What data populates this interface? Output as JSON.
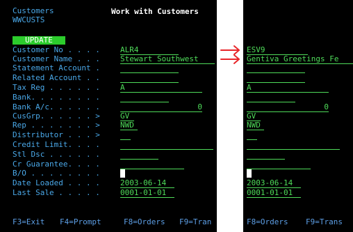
{
  "left": {
    "header": {
      "program_title": "Customers",
      "program_name": "WWCUSTS",
      "screen_title": "Work with Customers"
    },
    "mode_button": "UPDATE",
    "fields": [
      {
        "label": "Customer No . . . .",
        "value": "ALR4"
      },
      {
        "label": "Customer Name . . .",
        "value": "Stewart Southwest"
      },
      {
        "label": "Statement Account .",
        "value": ""
      },
      {
        "label": "Related Account . .",
        "value": ""
      },
      {
        "label": "Tax Reg . . . . . .",
        "value": "A"
      },
      {
        "label": "Bank. . . . . . . .",
        "value": ""
      },
      {
        "label": "Bank A/c. . . . . .",
        "value": "0"
      },
      {
        "label": "CusGrp. . . . . . >",
        "value": "GV"
      },
      {
        "label": "Rep . . . . . . . >",
        "value": "NWD"
      },
      {
        "label": "Distributor . . . >",
        "value": ""
      },
      {
        "label": "Credit Limit. . . .",
        "value": ""
      },
      {
        "label": "Stl Dsc . . . . . .",
        "value": ""
      },
      {
        "label": "Cr Guarantee. . . .",
        "value": ""
      },
      {
        "label": "B/O . . . . . . . .",
        "value": ""
      },
      {
        "label": "Date Loaded . . . .",
        "value": "2003-06-14"
      },
      {
        "label": "Last Sale . . . . .",
        "value": "0001-01-01"
      }
    ],
    "function_keys": [
      "F3=Exit",
      "F4=Prompt",
      "F8=Orders",
      "F9=Tran"
    ]
  },
  "right": {
    "values": {
      "customer_no": "ESV9",
      "customer_name": "Gentiva Greetings Fe",
      "tax_reg": "A",
      "bank_ac": "0",
      "cusgrp": "GV",
      "rep": "NWD",
      "date_loaded": "2003-06-14",
      "last_sale": "0001-01-01"
    },
    "function_keys": [
      "F8=Orders",
      "F9=Trans"
    ]
  },
  "colors": {
    "arrow": "#e8262a",
    "label": "#4aa8e8",
    "value": "#4fdc5a",
    "fkey": "#5d9fe6",
    "update_bg": "#2ccc2c"
  }
}
